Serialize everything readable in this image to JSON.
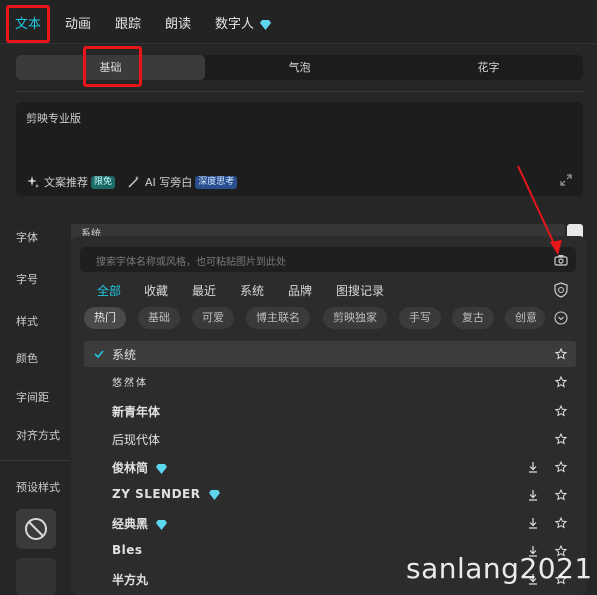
{
  "top_tabs": [
    {
      "label": "文本",
      "active": true
    },
    {
      "label": "动画",
      "active": false
    },
    {
      "label": "跟踪",
      "active": false
    },
    {
      "label": "朗读",
      "active": false
    },
    {
      "label": "数字人",
      "active": false,
      "icon": "diamond-icon"
    }
  ],
  "sub_tabs": [
    {
      "label": "基础",
      "active": true
    },
    {
      "label": "气泡",
      "active": false
    },
    {
      "label": "花字",
      "active": false
    }
  ],
  "text_input": {
    "value": "剪映专业版",
    "recommend_label": "文案推荐",
    "recommend_badge": "限免",
    "ai_label": "AI 写旁白",
    "ai_badge": "深度思考"
  },
  "properties": {
    "font_label": "字体",
    "font_value": "系统",
    "size_label": "字号",
    "style_label": "样式",
    "color_label": "颜色",
    "spacing_label": "字间距",
    "align_label": "对齐方式",
    "preset_label": "预设样式"
  },
  "font_dropdown": {
    "search_placeholder": "搜索字体名称或风格，也可粘贴图片到此处",
    "categories": [
      {
        "label": "全部",
        "active": true
      },
      {
        "label": "收藏",
        "active": false
      },
      {
        "label": "最近",
        "active": false
      },
      {
        "label": "系统",
        "active": false
      },
      {
        "label": "品牌",
        "active": false
      },
      {
        "label": "图搜记录",
        "active": false
      }
    ],
    "chips": [
      {
        "label": "热门",
        "active": true
      },
      {
        "label": "基础",
        "active": false
      },
      {
        "label": "可爱",
        "active": false
      },
      {
        "label": "博主联名",
        "active": false
      },
      {
        "label": "剪映独家",
        "active": false
      },
      {
        "label": "手写",
        "active": false
      },
      {
        "label": "复古",
        "active": false
      },
      {
        "label": "创意",
        "active": false
      }
    ],
    "fonts": [
      {
        "name": "系统",
        "selected": true,
        "vip": false,
        "download": false
      },
      {
        "name": "悠然体",
        "selected": false,
        "vip": false,
        "download": false
      },
      {
        "name": "新青年体",
        "selected": false,
        "vip": false,
        "download": false
      },
      {
        "name": "后现代体",
        "selected": false,
        "vip": false,
        "download": false
      },
      {
        "name": "俊林简",
        "selected": false,
        "vip": true,
        "download": true
      },
      {
        "name": "ZY SLENDER",
        "selected": false,
        "vip": true,
        "download": true
      },
      {
        "name": "经典黑",
        "selected": false,
        "vip": true,
        "download": true
      },
      {
        "name": "Bles",
        "selected": false,
        "vip": false,
        "download": true
      },
      {
        "name": "半方丸",
        "selected": false,
        "vip": false,
        "download": true
      }
    ]
  },
  "watermark": "sanlang2021",
  "colors": {
    "accent": "#1ec8e0",
    "highlight_box": "#e8161b",
    "vip_diamond": "#5fd6f0"
  }
}
